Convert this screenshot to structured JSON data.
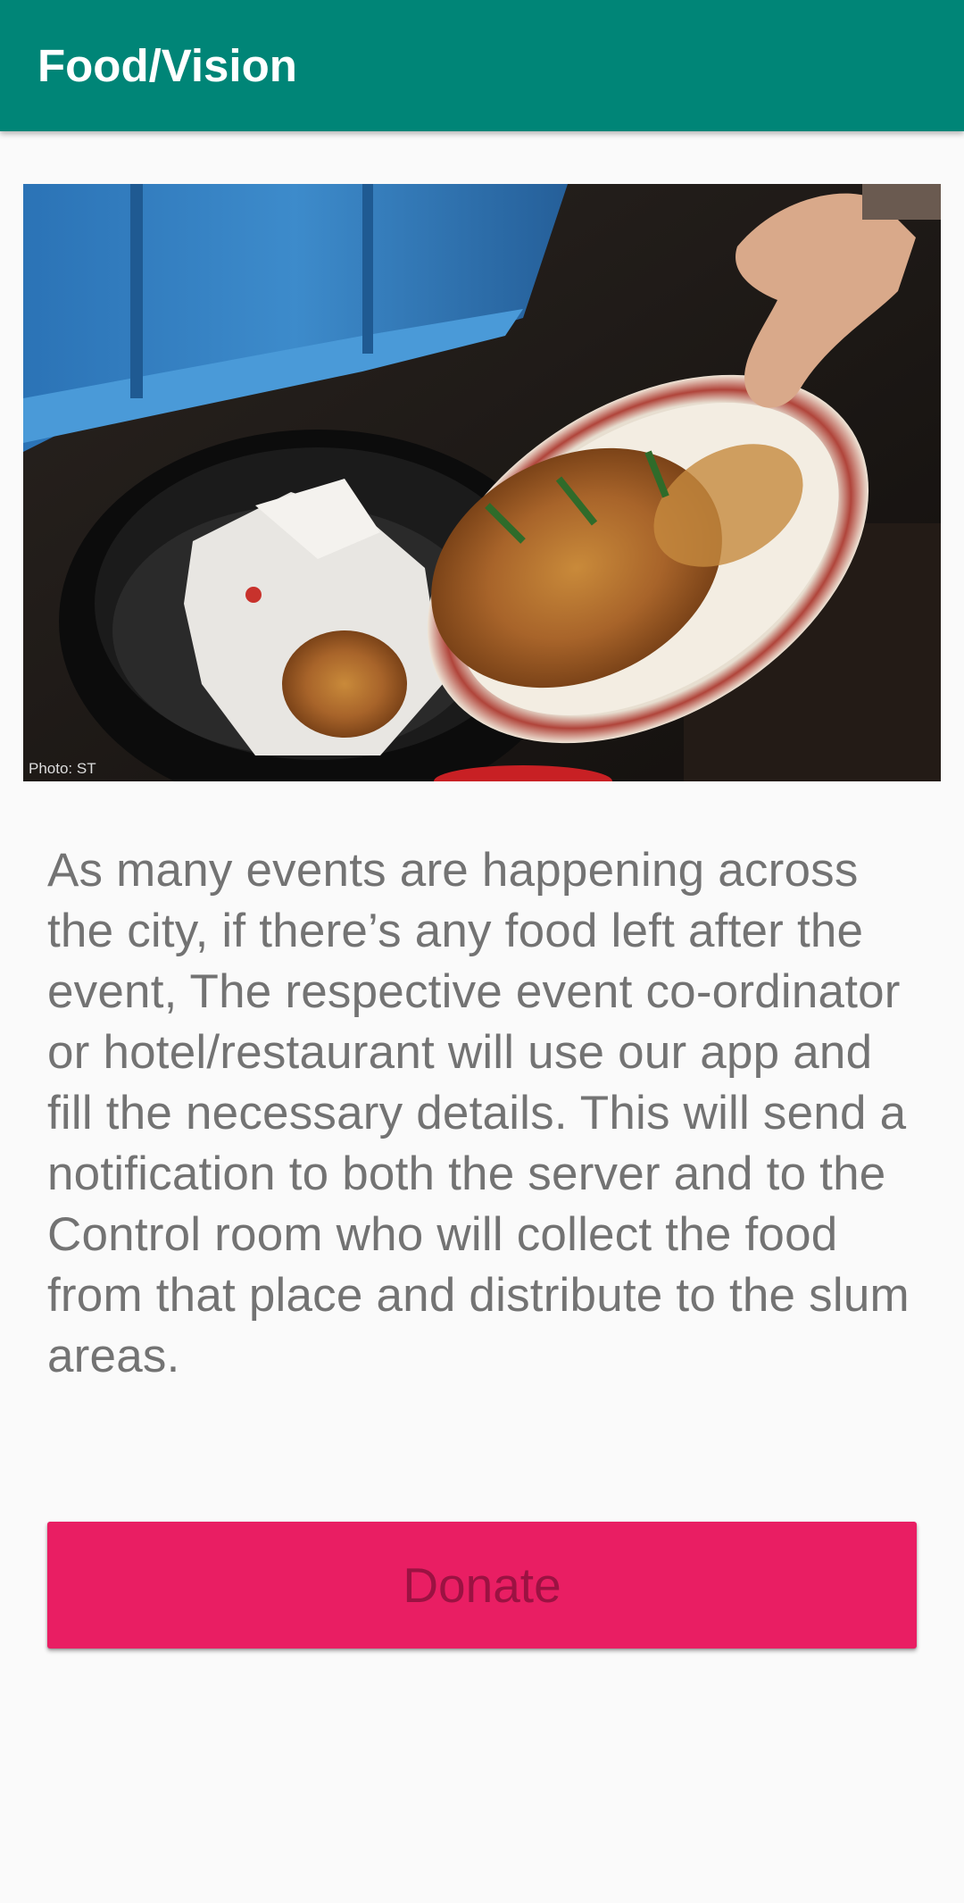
{
  "app_bar": {
    "title": "Food/Vision",
    "color": "#008577"
  },
  "hero_image": {
    "icon": "food-waste-photo",
    "caption": "Photo: ST"
  },
  "description": "As many events are happening across the city, if there’s any food left after the event, The respective event co-ordinator or hotel/restaurant will use our app and fill the necessary details. This will send a notification to both the server and to the Control room who will collect the food from that place and distribute to the slum areas.",
  "donate_button": {
    "label": "Donate",
    "color": "#e91e63"
  }
}
